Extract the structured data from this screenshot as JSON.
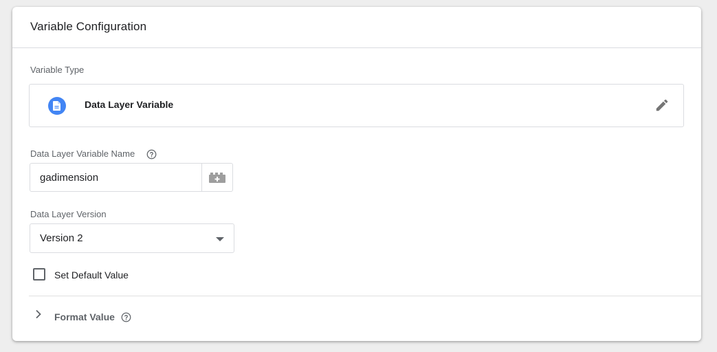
{
  "card": {
    "title": "Variable Configuration"
  },
  "variable_type": {
    "label": "Variable Type",
    "name": "Data Layer Variable",
    "icon": "document-icon",
    "icon_color": "#4285f4"
  },
  "data_layer_name": {
    "label": "Data Layer Variable Name",
    "value": "gadimension"
  },
  "data_layer_version": {
    "label": "Data Layer Version",
    "selected": "Version 2"
  },
  "default_value": {
    "label": "Set Default Value",
    "checked": false
  },
  "format_value": {
    "label": "Format Value",
    "expanded": false
  }
}
